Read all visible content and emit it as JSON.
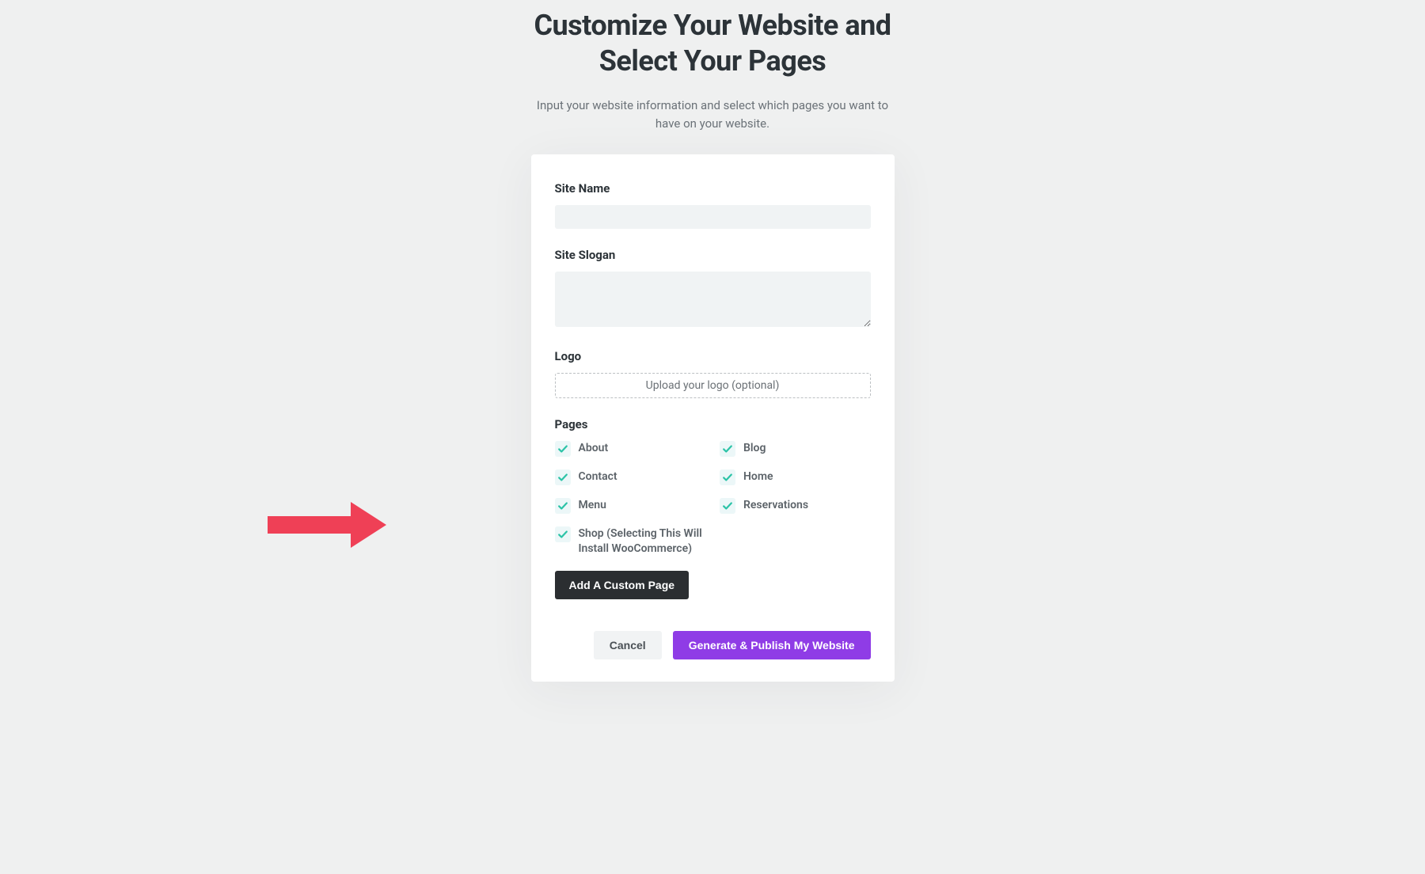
{
  "header": {
    "title": "Customize Your Website and Select Your Pages",
    "subtitle": "Input your website information and select which pages you want to have on your website."
  },
  "form": {
    "siteName": {
      "label": "Site Name",
      "value": ""
    },
    "siteSlogan": {
      "label": "Site Slogan",
      "value": ""
    },
    "logo": {
      "label": "Logo",
      "uploadText": "Upload your logo (optional)"
    },
    "pages": {
      "label": "Pages",
      "items": [
        {
          "label": "About",
          "checked": true
        },
        {
          "label": "Blog",
          "checked": true
        },
        {
          "label": "Contact",
          "checked": true
        },
        {
          "label": "Home",
          "checked": true
        },
        {
          "label": "Menu",
          "checked": true
        },
        {
          "label": "Reservations",
          "checked": true
        },
        {
          "label": "Shop (Selecting This Will Install WooCommerce)",
          "checked": true
        }
      ],
      "addCustomPageLabel": "Add A Custom Page"
    }
  },
  "actions": {
    "cancel": "Cancel",
    "generate": "Generate & Publish My Website"
  },
  "colors": {
    "accent": "#8f3ce6",
    "checkmark": "#2bc3a7",
    "arrow": "#ef4056"
  }
}
